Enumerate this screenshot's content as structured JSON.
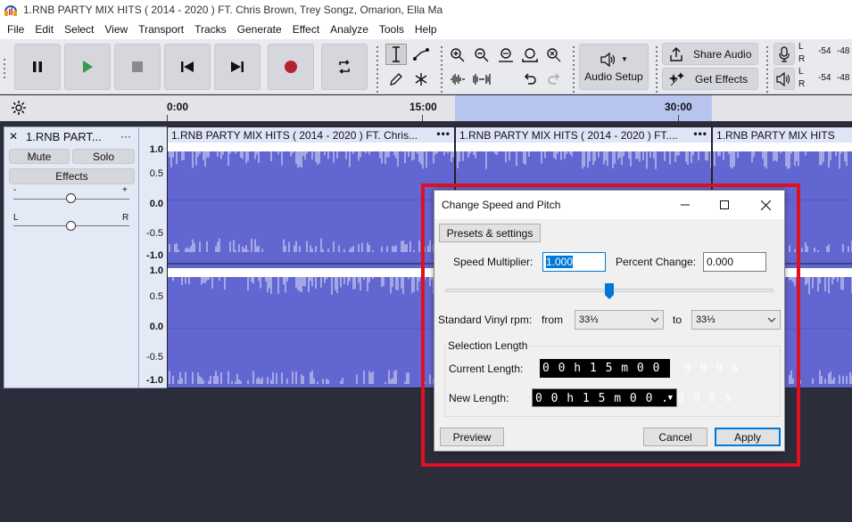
{
  "window": {
    "title": "1.RNB PARTY MIX HITS ( 2014 - 2020 ) FT. Chris Brown, Trey Songz, Omarion, Ella Ma"
  },
  "menu": [
    "File",
    "Edit",
    "Select",
    "View",
    "Transport",
    "Tracks",
    "Generate",
    "Effect",
    "Analyze",
    "Tools",
    "Help"
  ],
  "toolbar": {
    "audio_setup_label": "Audio Setup",
    "share_audio_label": "Share Audio",
    "get_effects_label": "Get Effects",
    "meter_record": {
      "channel_l": "L",
      "channel_r": "R",
      "v1": "-54",
      "v2": "-48"
    },
    "meter_play": {
      "channel_l": "L",
      "channel_r": "R",
      "v1": "-54",
      "v2": "-48"
    }
  },
  "timeline": {
    "ticks": [
      "0:00",
      "15:00",
      "30:00"
    ]
  },
  "track": {
    "name": "1.RNB PART...",
    "menu_dots": "···",
    "close_glyph": "✕",
    "mute_label": "Mute",
    "solo_label": "Solo",
    "effects_label": "Effects",
    "gain_minus": "-",
    "gain_plus": "+",
    "pan_l": "L",
    "pan_r": "R"
  },
  "vruler": {
    "top": [
      "1.0",
      "0.5",
      "0.0",
      "-0.5",
      "-1.0"
    ],
    "bottom": [
      "1.0",
      "0.5",
      "0.0",
      "-0.5",
      "-1.0"
    ]
  },
  "clips": [
    {
      "title": "1.RNB PARTY MIX HITS ( 2014 - 2020 ) FT. Chris...",
      "dots": "•••"
    },
    {
      "title": "1.RNB PARTY MIX HITS ( 2014 - 2020 ) FT....",
      "dots": "•••"
    },
    {
      "title": "1.RNB PARTY MIX HITS",
      "dots": ""
    }
  ],
  "dialog": {
    "title": "Change Speed and Pitch",
    "presets_label": "Presets & settings",
    "speed_multiplier_label": "Speed Multiplier:",
    "speed_multiplier_value": "1.000",
    "percent_change_label": "Percent Change:",
    "percent_change_value": "0.000",
    "slider_level": 0.5,
    "vinyl_label": "Standard Vinyl rpm:",
    "from_label": "from",
    "from_value": "33⅓",
    "to_label": "to",
    "to_value": "33⅓",
    "selection_length_label": "Selection Length",
    "current_length_label": "Current Length:",
    "current_length_value": "0 0 h 1 5 m 0 0 . 9 9 9 s",
    "new_length_label": "New Length:",
    "new_length_value": "0 0 h 1 5 m 0 0 . 9 9 9 s",
    "preview_label": "Preview",
    "cancel_label": "Cancel",
    "apply_label": "Apply"
  },
  "colors": {
    "waveform": "#6266d0",
    "selection": "#b7c5ee",
    "highlight_frame": "#e01020",
    "record_button": "#b5222f",
    "play_button": "#3a9a4a"
  }
}
